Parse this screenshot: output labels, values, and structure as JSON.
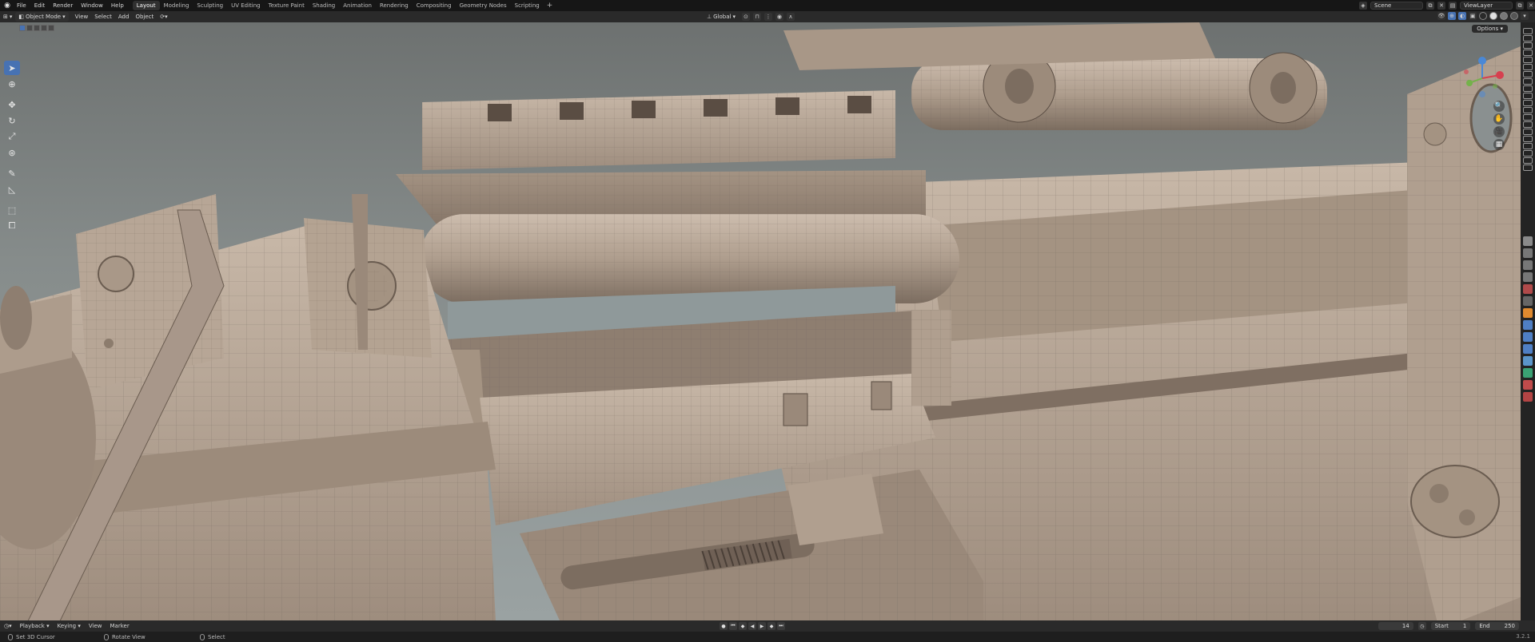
{
  "menubar": {
    "items": [
      "File",
      "Edit",
      "Render",
      "Window",
      "Help"
    ],
    "workspaces": [
      "Layout",
      "Modeling",
      "Sculpting",
      "UV Editing",
      "Texture Paint",
      "Shading",
      "Animation",
      "Rendering",
      "Compositing",
      "Geometry Nodes",
      "Scripting"
    ],
    "active_workspace": "Layout",
    "add_tab": "+",
    "scene": "Scene",
    "view_layer": "ViewLayer"
  },
  "header": {
    "mode": "Object Mode",
    "menus": [
      "View",
      "Select",
      "Add",
      "Object"
    ],
    "transform_orientation": "Global",
    "options": "Options"
  },
  "tools": [
    "select-box",
    "cursor",
    "move",
    "rotate",
    "scale",
    "transform",
    "annotate",
    "measure",
    "add-cube",
    "transform-extra"
  ],
  "timeline": {
    "menus": [
      "Playback",
      "Keying",
      "View",
      "Marker"
    ],
    "current_frame": "14",
    "start_label": "Start",
    "start": "1",
    "end_label": "End",
    "end": "250"
  },
  "statusbar": {
    "hints": [
      "Set 3D Cursor",
      "Rotate View",
      "Select"
    ],
    "version": "3.2.1"
  },
  "colors": {
    "accent": "#4772b3",
    "model": "#b4a392",
    "background": "#868c8b"
  }
}
